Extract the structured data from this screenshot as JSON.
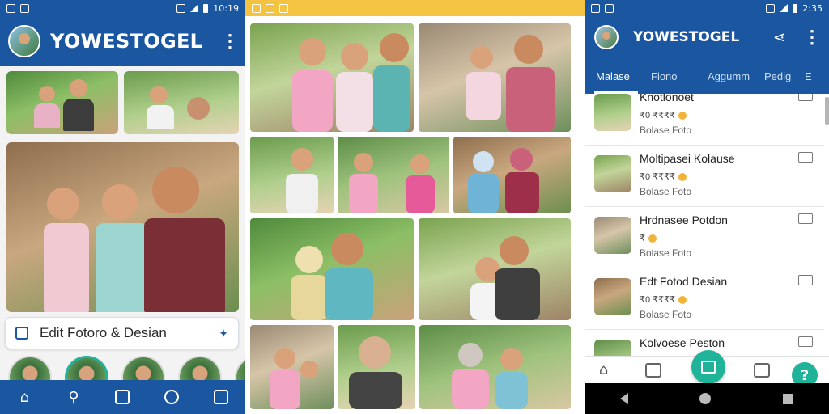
{
  "left_screen": {
    "status_bar": {
      "time": "10:19"
    },
    "app_title": "YOWESTOGEL",
    "edit_bar_label": "Edit Fotoro & Desian",
    "bottom_nav": [
      "home-icon",
      "search-icon",
      "info-icon",
      "profile-icon",
      "flash-icon"
    ]
  },
  "right_screen": {
    "status_bar": {
      "time": "2:35"
    },
    "app_title": "YOWESTOGEL",
    "tabs": [
      "Malase",
      "Fiono",
      "Aggumm",
      "Pedig",
      "E"
    ],
    "list": [
      {
        "title": "Knotlonoet",
        "meta": "₹0 ₹₹₹₹",
        "sub": "Bolase Foto"
      },
      {
        "title": "Moltipasei Kolause",
        "meta": "₹0 ₹₹₹₹",
        "sub": "Bolase Foto"
      },
      {
        "title": "Hrdnasee Potdon",
        "meta": "₹",
        "sub": "Bolase Foto"
      },
      {
        "title": "Edt Fotod Desian",
        "meta": "₹0 ₹₹₹₹",
        "sub": "Bolase Foto"
      },
      {
        "title": "Kolvoese Peston",
        "meta": "",
        "sub": ""
      }
    ],
    "help_label": "?"
  },
  "colors": {
    "primary": "#1b56a0",
    "accent": "#1fb39a",
    "status_yellow": "#f5c342"
  }
}
